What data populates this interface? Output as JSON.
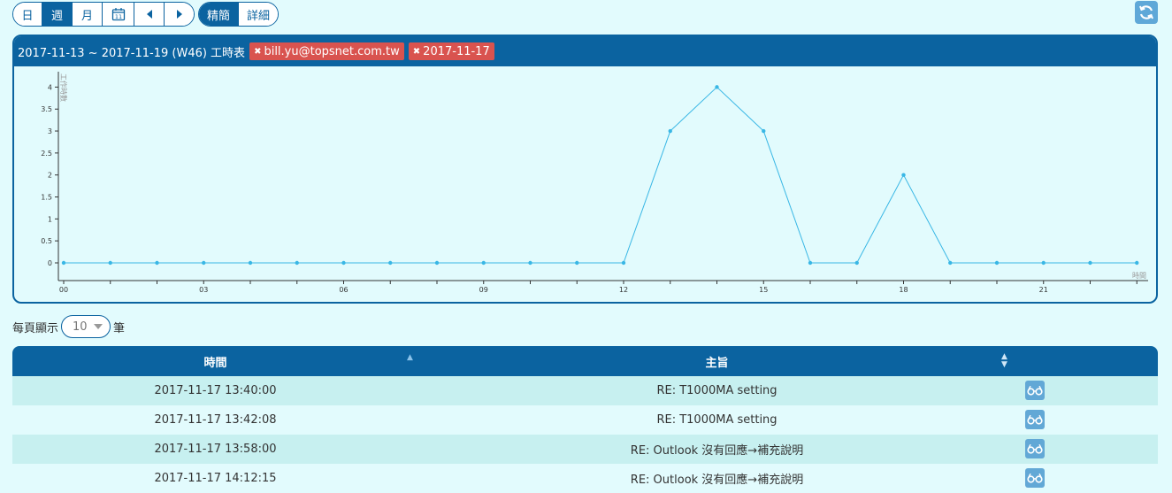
{
  "toolbar": {
    "day_label": "日",
    "week_label": "週",
    "month_label": "月",
    "calendar_icon_text": "11",
    "mode_brief_label": "精簡",
    "mode_detail_label": "詳細"
  },
  "panel": {
    "title": "2017-11-13 ~ 2017-11-19 (W46) 工時表",
    "filters": [
      {
        "label": "bill.yu@topsnet.com.tw"
      },
      {
        "label": "2017-11-17"
      }
    ]
  },
  "chart_data": {
    "type": "line",
    "ylabel": "工作時數",
    "xlabel": "時間",
    "x": [
      "00",
      "01",
      "02",
      "03",
      "04",
      "05",
      "06",
      "07",
      "08",
      "09",
      "10",
      "11",
      "12",
      "13",
      "14",
      "15",
      "16",
      "17",
      "18",
      "19",
      "20",
      "21",
      "22",
      "23"
    ],
    "values": [
      0,
      0,
      0,
      0,
      0,
      0,
      0,
      0,
      0,
      0,
      0,
      0,
      0,
      3,
      4,
      3,
      0,
      0,
      2,
      0,
      0,
      0,
      0,
      0
    ],
    "x_tick_labels": [
      "00",
      "03",
      "06",
      "09",
      "12",
      "15",
      "18",
      "21"
    ],
    "y_tick_labels": [
      "0",
      "0.5",
      "1",
      "1.5",
      "2",
      "2.5",
      "3",
      "3.5",
      "4"
    ],
    "ylim": [
      0,
      4.35
    ],
    "line_color": "#39b7e5",
    "grid": false
  },
  "pager": {
    "prefix": "每頁顯示",
    "page_size": "10",
    "suffix": "筆"
  },
  "table": {
    "headers": {
      "time": "時間",
      "subject": "主旨"
    },
    "rows": [
      {
        "time": "2017-11-17 13:40:00",
        "subject": "RE: T1000MA setting"
      },
      {
        "time": "2017-11-17 13:42:08",
        "subject": "RE: T1000MA setting"
      },
      {
        "time": "2017-11-17 13:58:00",
        "subject": "RE: Outlook 沒有回應→補充說明"
      },
      {
        "time": "2017-11-17 14:12:15",
        "subject": "RE: Outlook 沒有回應→補充說明"
      }
    ]
  },
  "colors": {
    "primary": "#0b63a0",
    "background": "#e2fbfd",
    "tag_red": "#d9534f",
    "row_alt": "#c7f0f0",
    "icon_blue": "#62a8d6"
  }
}
